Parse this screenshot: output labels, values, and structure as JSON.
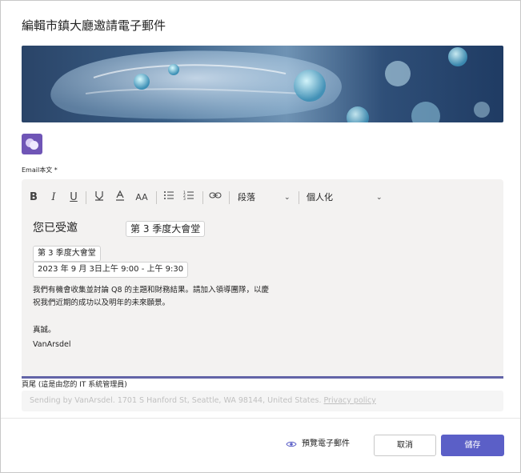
{
  "dialog": {
    "title": "編輯市鎮大廳邀請電子郵件",
    "email_body_label": "Email本文 *"
  },
  "toolbar": {
    "bold": "B",
    "italic": "I",
    "underline": "U",
    "highlight": "highlight-icon",
    "font_color": "font-color-icon",
    "font_size": "AA",
    "paragraph_label": "段落",
    "personalize_label": "個人化"
  },
  "content": {
    "invited": "您已受邀",
    "event_chip": "第 3 季度大會堂",
    "event_name_chip": "第 3 季度大會堂",
    "datetime_chip": "2023 年 9 月 3日上午 9:00 - 上午 9:30",
    "body_line1": "我們有機會收集並討論 Q8 的主題和財務結果。請加入領導團隊，以慶",
    "body_line2": "祝我們近期的成功以及明年的未來願景。",
    "closing": "真誠。",
    "signature": "VanArsdel"
  },
  "footer": {
    "label": "頁尾 (這是由您的 IT 系統管理員)",
    "text": "Sending by VanArsdel. 1701 S Hanford St, Seattle, WA 98144, United States.",
    "link": "Privacy policy"
  },
  "actions": {
    "preview_label": "預覽電子郵件",
    "cancel_label": "取消",
    "save_label": "儲存"
  },
  "colors": {
    "accent": "#5b5fc7",
    "editor_underline": "#6264a7",
    "logo": "#6f55b6"
  }
}
